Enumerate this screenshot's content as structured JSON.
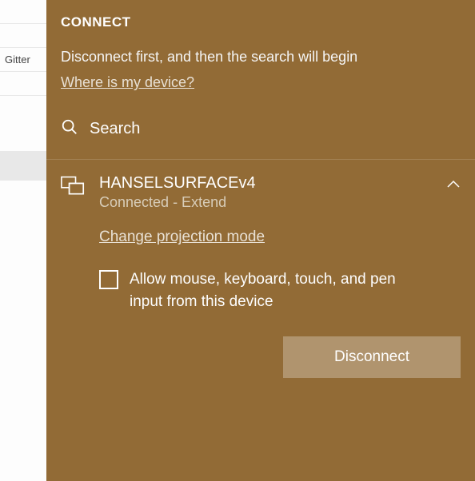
{
  "background": {
    "side_label": "Gitter"
  },
  "panel": {
    "title": "CONNECT",
    "subtitle": "Disconnect first, and then the search will begin",
    "where_link": "Where is my device?",
    "search_label": "Search"
  },
  "device": {
    "name": "HANSELSURFACEv4",
    "status": "Connected - Extend",
    "projection_link": "Change projection mode",
    "allow_input_label": "Allow mouse, keyboard, touch, and pen input from this device",
    "disconnect_label": "Disconnect"
  }
}
